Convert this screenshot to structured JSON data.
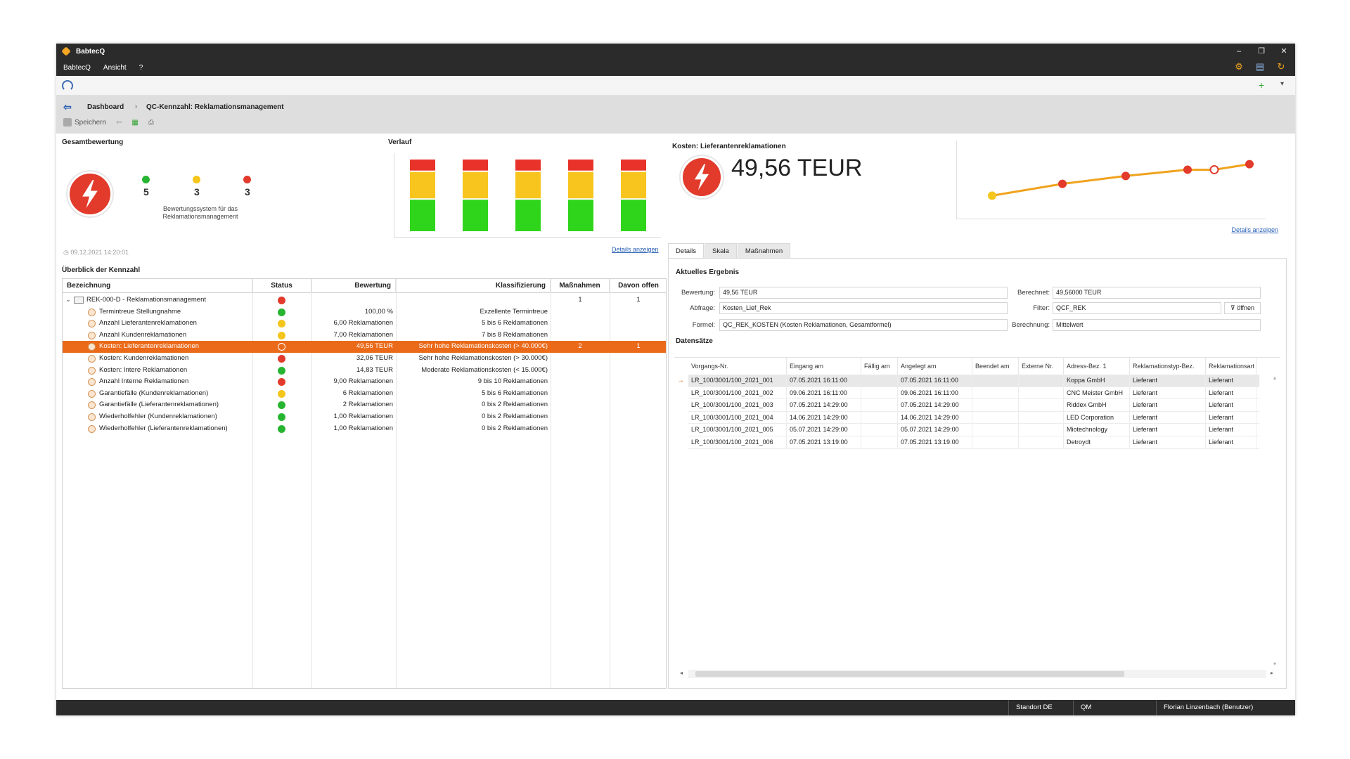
{
  "window": {
    "title": "BabtecQ",
    "controls": [
      "–",
      "❐",
      "✕"
    ]
  },
  "menu": {
    "items": [
      "BabtecQ",
      "Ansicht",
      "?"
    ]
  },
  "breadcrumb": {
    "home": "Dashboard",
    "separator": "›",
    "current": "QC-Kennzahl: Reklamationsmanagement"
  },
  "toolbar": {
    "save_label": "Speichern"
  },
  "overall": {
    "title": "Gesamtbewertung",
    "counts": {
      "green": "5",
      "yellow": "3",
      "red": "3"
    },
    "description_line1": "Bewertungssystem für das",
    "description_line2": "Reklamationsmanagement",
    "timestamp": "09.12.2021 14:20:01"
  },
  "verlauf": {
    "title": "Verlauf",
    "details_link": "Details anzeigen",
    "stack_levels": {
      "red": 0.17,
      "yellow": 0.38,
      "green": 0.45
    },
    "bar_count": 5
  },
  "overview": {
    "title": "Überblick der Kennzahl",
    "columns": {
      "name": "Bezeichnung",
      "status": "Status",
      "value": "Bewertung",
      "class": "Klassifizierung",
      "actions": "Maßnahmen",
      "open": "Davon offen"
    },
    "root": {
      "name": "REK-000-D - Reklamationsmanagement",
      "status": "red",
      "actions": "1",
      "open": "1"
    },
    "rows": [
      {
        "name": "Termintreue Stellungnahme",
        "status": "green",
        "value": "100,00 %",
        "class": "Exzellente Termintreue",
        "actions": "",
        "open": ""
      },
      {
        "name": "Anzahl Lieferantenreklamationen",
        "status": "yellow",
        "value": "6,00 Reklamationen",
        "class": "5 bis 6 Reklamationen",
        "actions": "",
        "open": ""
      },
      {
        "name": "Anzahl Kundenreklamationen",
        "status": "yellow",
        "value": "7,00 Reklamationen",
        "class": "7 bis 8 Reklamationen",
        "actions": "",
        "open": ""
      },
      {
        "name": "Kosten: Lieferantenreklamationen",
        "status": "red",
        "value": "49,56 TEUR",
        "class": "Sehr hohe Reklamationskosten (> 40.000€)",
        "actions": "2",
        "open": "1",
        "selected": true
      },
      {
        "name": "Kosten: Kundenreklamationen",
        "status": "red",
        "value": "32,06 TEUR",
        "class": "Sehr hohe Reklamationskosten (> 30.000€)",
        "actions": "",
        "open": ""
      },
      {
        "name": "Kosten: Intere Reklamationen",
        "status": "green",
        "value": "14,83 TEUR",
        "class": "Moderate Reklamationskosten (< 15.000€)",
        "actions": "",
        "open": ""
      },
      {
        "name": "Anzahl Interne Reklamationen",
        "status": "red",
        "value": "9,00 Reklamationen",
        "class": "9 bis 10 Reklamationen",
        "actions": "",
        "open": ""
      },
      {
        "name": "Garantiefälle (Kundenreklamationen)",
        "status": "yellow",
        "value": "6 Reklamationen",
        "class": "5 bis 6 Reklamationen",
        "actions": "",
        "open": ""
      },
      {
        "name": "Garantiefälle (Lieferantenreklamationen)",
        "status": "green",
        "value": "2 Reklamationen",
        "class": "0 bis 2 Reklamationen",
        "actions": "",
        "open": ""
      },
      {
        "name": "Wiederholfehler (Kundenreklamationen)",
        "status": "green",
        "value": "1,00 Reklamationen",
        "class": "0 bis 2 Reklamationen",
        "actions": "",
        "open": ""
      },
      {
        "name": "Wiederholfehler (Lieferantenreklamationen)",
        "status": "green",
        "value": "1,00 Reklamationen",
        "class": "0 bis 2 Reklamationen",
        "actions": "",
        "open": ""
      }
    ]
  },
  "kpi": {
    "title": "Kosten: Lieferantenreklamationen",
    "value": "49,56 TEUR",
    "details_link": "Details anzeigen",
    "trend_points": [
      {
        "v": 0.3,
        "color": "yellow",
        "hollow": false
      },
      {
        "v": 0.45,
        "color": "red",
        "hollow": false
      },
      {
        "v": 0.55,
        "color": "red",
        "hollow": false
      },
      {
        "v": 0.63,
        "color": "red",
        "hollow": false
      },
      {
        "v": 0.63,
        "color": "red",
        "hollow": true
      },
      {
        "v": 0.7,
        "color": "red",
        "hollow": false
      }
    ]
  },
  "tabs": [
    "Details",
    "Skala",
    "Maßnahmen"
  ],
  "result": {
    "title": "Aktuelles Ergebnis",
    "bewertung_label": "Bewertung:",
    "bewertung": "49,56 TEUR",
    "berechnet_label": "Berechnet:",
    "berechnet": "49,56000 TEUR",
    "abfrage_label": "Abfrage:",
    "abfrage": "Kosten_Lief_Rek",
    "filter_label": "Filter:",
    "filter": "QCF_REK",
    "open_label": "öffnen",
    "formel_label": "Formel:",
    "formel": "QC_REK_KOSTEN  (Kosten Reklamationen, Gesamtformel)",
    "berechnung_label": "Berechnung:",
    "berechnung": "Mittelwert"
  },
  "records": {
    "title": "Datensätze",
    "columns": [
      "Vorgangs-Nr.",
      "Eingang am",
      "Fällig am",
      "Angelegt am",
      "Beendet am",
      "Externe Nr.",
      "Adress-Bez. 1",
      "Reklamationstyp-Bez.",
      "Reklamationsart"
    ],
    "rows": [
      [
        "LR_100/3001/100_2021_001",
        "07.05.2021 16:11:00",
        "",
        "07.05.2021 16:11:00",
        "",
        "",
        "Koppa GmbH",
        "Lieferant",
        "Lieferant"
      ],
      [
        "LR_100/3001/100_2021_002",
        "09.06.2021 16:11:00",
        "",
        "09.06.2021 16:11:00",
        "",
        "",
        "CNC Meister GmbH",
        "Lieferant",
        "Lieferant"
      ],
      [
        "LR_100/3001/100_2021_003",
        "07.05.2021 14:29:00",
        "",
        "07.05.2021 14:29:00",
        "",
        "",
        "Riddex GmbH",
        "Lieferant",
        "Lieferant"
      ],
      [
        "LR_100/3001/100_2021_004",
        "14.06.2021 14:29:00",
        "",
        "14.06.2021 14:29:00",
        "",
        "",
        "LED Corporation",
        "Lieferant",
        "Lieferant"
      ],
      [
        "LR_100/3001/100_2021_005",
        "05.07.2021 14:29:00",
        "",
        "05.07.2021 14:29:00",
        "",
        "",
        "Miotechnology",
        "Lieferant",
        "Lieferant"
      ],
      [
        "LR_100/3001/100_2021_006",
        "07.05.2021 13:19:00",
        "",
        "07.05.2021 13:19:00",
        "",
        "",
        "Detroydt",
        "Lieferant",
        "Lieferant"
      ]
    ]
  },
  "status": {
    "location": "Standort DE",
    "module": "QM",
    "user": "Florian Linzenbach (Benutzer)"
  },
  "colors": {
    "red": "#e23b2b",
    "yellow": "#f4c51b",
    "green": "#27b531",
    "orange": "#ea6a1a",
    "bar_red": "#e8332a",
    "bar_yellow": "#f7c51d",
    "bar_green": "#2fd51a",
    "line": "#f0a31e"
  }
}
